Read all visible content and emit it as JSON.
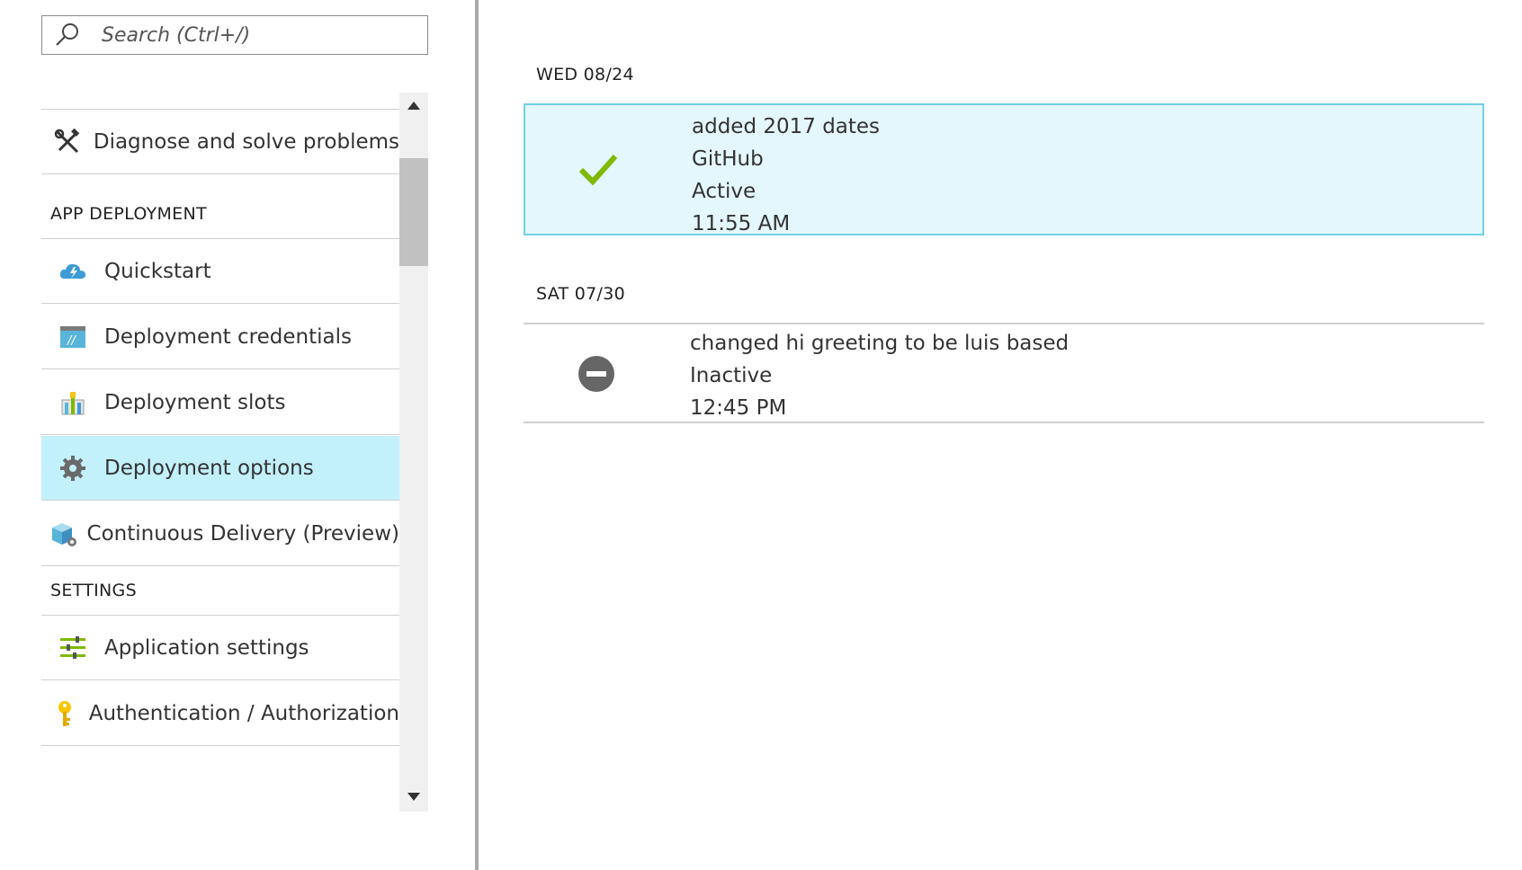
{
  "search": {
    "placeholder": "Search (Ctrl+/)",
    "icon": "search-icon"
  },
  "menu": {
    "partial_item_dash": "-",
    "items_top": [
      {
        "label": "Diagnose and solve problems",
        "icon": "wrench-screwdriver-icon"
      }
    ],
    "sections": [
      {
        "title": "APP DEPLOYMENT",
        "items": [
          {
            "label": "Quickstart",
            "icon": "cloud-lightning-icon"
          },
          {
            "label": "Deployment credentials",
            "icon": "credentials-icon"
          },
          {
            "label": "Deployment slots",
            "icon": "slots-icon"
          },
          {
            "label": "Deployment options",
            "icon": "gear-icon",
            "selected": true
          },
          {
            "label": "Continuous Delivery (Preview)",
            "icon": "cube-icon"
          }
        ]
      },
      {
        "title": "SETTINGS",
        "items": [
          {
            "label": "Application settings",
            "icon": "sliders-icon"
          },
          {
            "label": "Authentication / Authorization",
            "icon": "key-icon"
          }
        ]
      }
    ]
  },
  "deployments": [
    {
      "date": "WED 08/24",
      "entries": [
        {
          "message": "added 2017 dates",
          "source": "GitHub",
          "status": "Active",
          "time": "11:55 AM",
          "status_icon": "check-icon"
        }
      ]
    },
    {
      "date": "SAT 07/30",
      "entries": [
        {
          "message": "changed hi greeting to be luis based",
          "status": "Inactive",
          "time": "12:45 PM",
          "status_icon": "minus-circle-icon"
        }
      ]
    }
  ],
  "colors": {
    "selected_bg": "#c2f0fb",
    "active_bg": "#e4f7fd",
    "active_border": "#6fd0ea",
    "check": "#7fba00",
    "inactive_icon": "#666666"
  }
}
